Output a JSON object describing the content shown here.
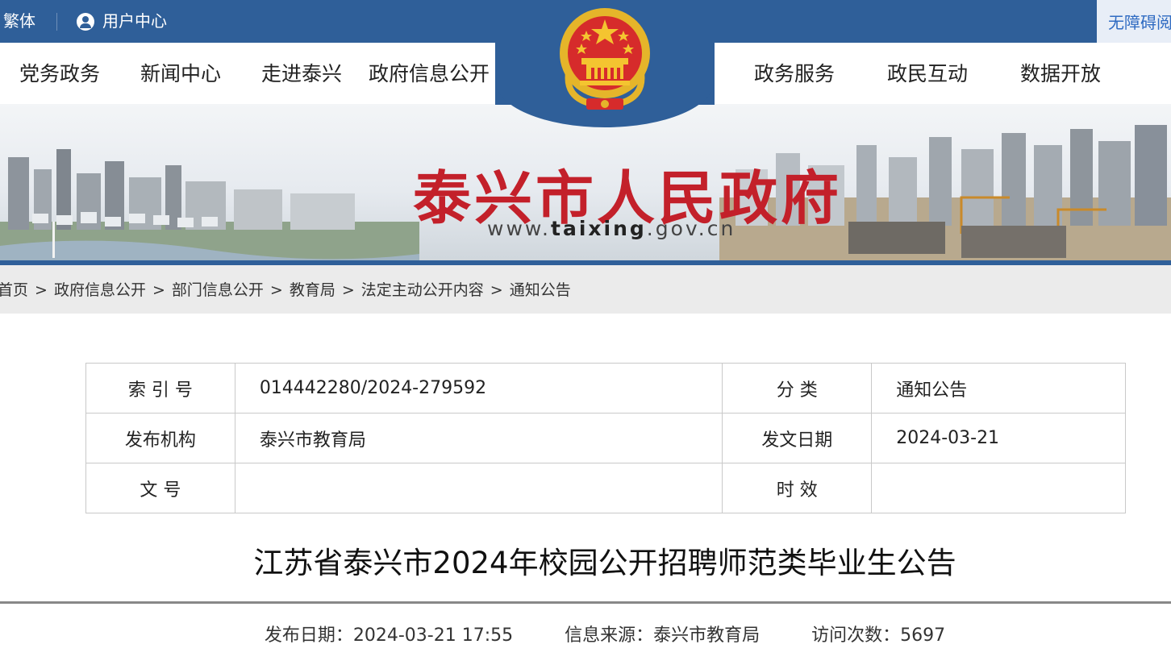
{
  "topbar": {
    "traditional": "繁体",
    "user_center": "用户中心",
    "accessibility": "无障碍阅读"
  },
  "nav": {
    "items": [
      "党务政务",
      "新闻中心",
      "走进泰兴",
      "政府信息公开",
      "政务服务",
      "政民互动",
      "数据开放"
    ]
  },
  "banner": {
    "title": "泰兴市人民政府",
    "url_prefix": "www.",
    "url_domain": "taixing",
    "url_suffix": ".gov.cn"
  },
  "breadcrumb": [
    "首页",
    "政府信息公开",
    "部门信息公开",
    "教育局",
    "法定主动公开内容",
    "通知公告"
  ],
  "breadcrumb_sep": ">",
  "info": {
    "index_label": "索 引 号",
    "index_value": "014442280/2024-279592",
    "category_label": "分 类",
    "category_value": "通知公告",
    "org_label": "发布机构",
    "org_value": "泰兴市教育局",
    "date_label": "发文日期",
    "date_value": "2024-03-21",
    "docno_label": "文 号",
    "docno_value": "",
    "validity_label": "时 效",
    "validity_value": ""
  },
  "article": {
    "title": "江苏省泰兴市2024年校园公开招聘师范类毕业生公告",
    "publish_date": "发布日期：2024-03-21 17:55",
    "source": "信息来源：泰兴市教育局",
    "visits": "访问次数：5697"
  },
  "colors": {
    "brand_blue": "#2f5f99",
    "title_red": "#c3202a"
  }
}
